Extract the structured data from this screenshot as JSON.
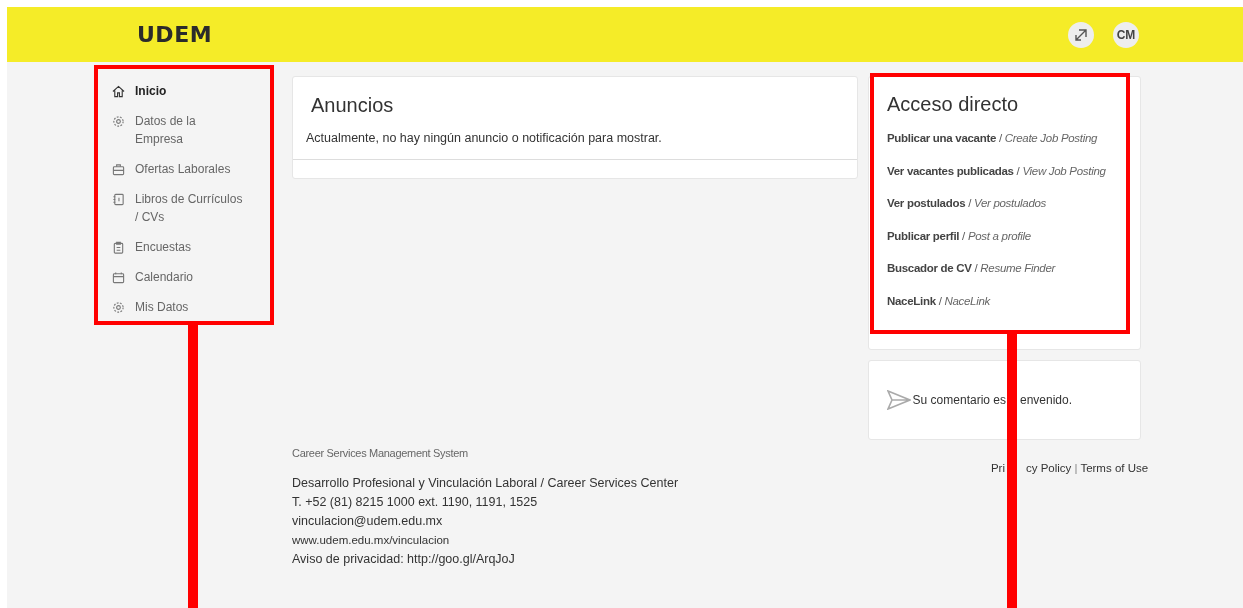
{
  "header": {
    "logo": "UDEM",
    "avatar": "CM"
  },
  "sidebar": {
    "items": [
      {
        "label": "Inicio",
        "selected": true
      },
      {
        "label": "Datos de la Empresa",
        "selected": false
      },
      {
        "label": "Ofertas Laborales",
        "selected": false
      },
      {
        "label": "Libros de Currículos / CVs",
        "selected": false
      },
      {
        "label": "Encuestas",
        "selected": false
      },
      {
        "label": "Calendario",
        "selected": false
      },
      {
        "label": "Mis Datos",
        "selected": false
      }
    ]
  },
  "announcements": {
    "title": "Anuncios",
    "message": "Actualmente, no hay ningún anuncio o notificación para mostrar."
  },
  "quick_access": {
    "title": "Acceso directo",
    "links": [
      "**Publicar una vacante** / *Create Job Posting*",
      "**Ver vacantes publicadas** / *View Job Posting*",
      "**Ver postulados** / *Ver postulados*",
      "**Publicar perfil** / *Post a profile*",
      "**Buscador de CV** / *Resume Finder*",
      "**NaceLink** / *NaceLink*"
    ]
  },
  "feedback": {
    "message_start": "Su comentario es",
    "message_end": "envenido."
  },
  "footer": {
    "system": "Career Services Management System",
    "lines": [
      "Desarrollo Profesional y Vinculación Laboral / Career Services Center",
      "T. +52 (81) 8215 1000 ext. 1190, 1191, 1525",
      "vinculacion@udem.edu.mx",
      "www.udem.edu.mx/vinculacion",
      "Aviso de privacidad: http://goo.gl/ArqJoJ"
    ],
    "links": [
      "Pri",
      "cy Policy",
      "Terms of Use"
    ],
    "separator": "|"
  }
}
